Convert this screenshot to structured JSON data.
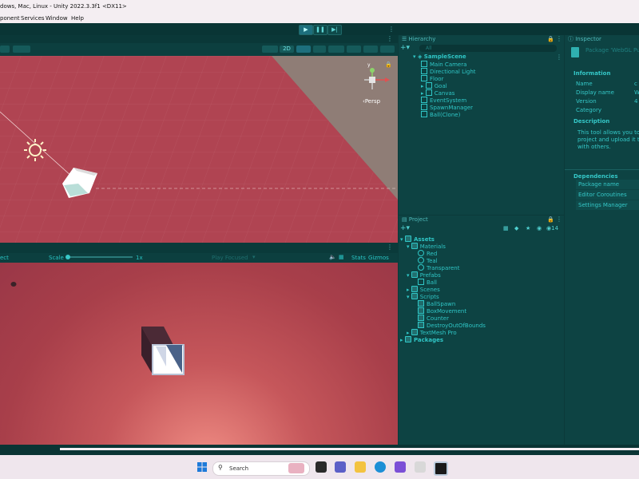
{
  "window": {
    "title": "dows, Mac, Linux - Unity 2022.3.3f1 <DX11>"
  },
  "menu": [
    "ponent",
    "Services",
    "Window",
    "Help"
  ],
  "toolbar": {
    "play_icon": "play-icon",
    "pause_icon": "pause-icon",
    "step_icon": "step-icon"
  },
  "scene_view": {
    "toolbar_2d": "2D",
    "persp_label": "Persp",
    "gizmo_axis": "y"
  },
  "game_view": {
    "display_select": "ect",
    "scale_label": "Scale",
    "scale_value": "1x",
    "play_mode_select": "Play Focused",
    "stats_label": "Stats",
    "gizmos_label": "Gizmos"
  },
  "hierarchy": {
    "tab_label": "Hierarchy",
    "search_placeholder": "All",
    "scene_name": "SampleScene",
    "items": [
      {
        "label": "Main Camera",
        "expandable": false
      },
      {
        "label": "Directional Light",
        "expandable": false
      },
      {
        "label": "Floor",
        "expandable": false
      },
      {
        "label": "Goal",
        "expandable": true
      },
      {
        "label": "Canvas",
        "expandable": true
      },
      {
        "label": "EventSystem",
        "expandable": false
      },
      {
        "label": "SpawnManager",
        "expandable": false
      },
      {
        "label": "Ball(Clone)",
        "expandable": false
      }
    ]
  },
  "project": {
    "tab_label": "Project",
    "hidden_count": "14",
    "tree": [
      {
        "label": "Assets",
        "level": 0,
        "kind": "folder",
        "bold": true
      },
      {
        "label": "Materials",
        "level": 1,
        "kind": "folder"
      },
      {
        "label": "Red",
        "level": 2,
        "kind": "material"
      },
      {
        "label": "Teal",
        "level": 2,
        "kind": "material"
      },
      {
        "label": "Transparent",
        "level": 2,
        "kind": "material"
      },
      {
        "label": "Prefabs",
        "level": 1,
        "kind": "folder"
      },
      {
        "label": "Ball",
        "level": 2,
        "kind": "prefab"
      },
      {
        "label": "Scenes",
        "level": 1,
        "kind": "folder"
      },
      {
        "label": "Scripts",
        "level": 1,
        "kind": "folder"
      },
      {
        "label": "BallSpawn",
        "level": 2,
        "kind": "script"
      },
      {
        "label": "BoxMovement",
        "level": 2,
        "kind": "script"
      },
      {
        "label": "Counter",
        "level": 2,
        "kind": "script"
      },
      {
        "label": "DestroyOutOfBounds",
        "level": 2,
        "kind": "script"
      },
      {
        "label": "TextMesh Pro",
        "level": 1,
        "kind": "folder"
      },
      {
        "label": "Packages",
        "level": 0,
        "kind": "folder",
        "bold": true
      }
    ]
  },
  "inspector": {
    "tab_label": "Inspector",
    "header": "Package 'WebGL Pu",
    "information_heading": "Information",
    "fields": [
      {
        "label": "Name",
        "value": "c"
      },
      {
        "label": "Display name",
        "value": "W"
      },
      {
        "label": "Version",
        "value": "4"
      },
      {
        "label": "Category",
        "value": ""
      }
    ],
    "description_heading": "Description",
    "description_lines": [
      "This tool allows you to m",
      "project and upload it to U",
      "with others."
    ],
    "dependencies_heading": "Dependencies",
    "dependencies": [
      "Package name",
      "Editor Coroutines",
      "Settings Manager"
    ]
  },
  "taskbar": {
    "search_placeholder": "Search"
  },
  "colors": {
    "accent": "#29c4c4",
    "panel_bg": "#0d4343",
    "floor_red": "#b04452",
    "game_red": "#a83f4a"
  }
}
